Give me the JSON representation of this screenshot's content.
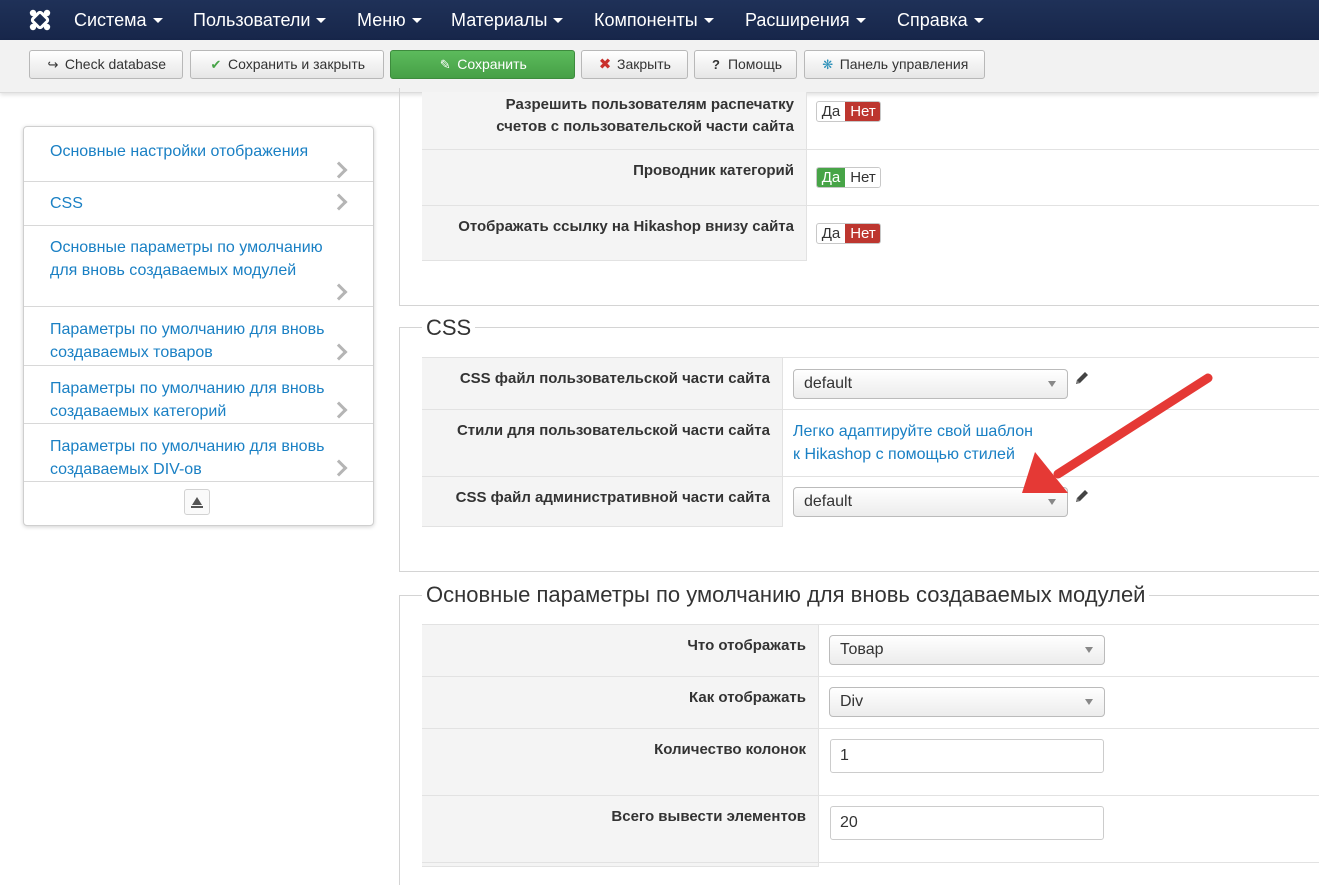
{
  "nav": {
    "items": [
      {
        "label": "Система"
      },
      {
        "label": "Пользователи"
      },
      {
        "label": "Меню"
      },
      {
        "label": "Материалы"
      },
      {
        "label": "Компоненты"
      },
      {
        "label": "Расширения"
      },
      {
        "label": "Справка"
      }
    ]
  },
  "toolbar": {
    "check_db": "Check database",
    "save_close": "Сохранить и закрыть",
    "save": "Сохранить",
    "close": "Закрыть",
    "help": "Помощь",
    "cpanel": "Панель управления"
  },
  "sidebar": {
    "items": [
      {
        "label": "Основные настройки отображения"
      },
      {
        "label": "CSS"
      },
      {
        "label": "Основные параметры по умолчанию для вновь создаваемых модулей"
      },
      {
        "label": "Параметры по умолчанию для вновь создаваемых товаров"
      },
      {
        "label": "Параметры по умолчанию для вновь создаваемых категорий"
      },
      {
        "label": "Параметры по умолчанию для вновь создаваемых DIV-ов"
      }
    ]
  },
  "display": {
    "rows": [
      {
        "label_l1": "Разрешить пользователям распечатку",
        "label_l2": "счетов с пользовательской части сайта",
        "yes": "Да",
        "no": "Нет",
        "value": "no"
      },
      {
        "label_l1": "Проводник категорий",
        "yes": "Да",
        "no": "Нет",
        "value": "yes"
      },
      {
        "label_l1": "Отображать ссылку на Hikashop внизу сайта",
        "yes": "Да",
        "no": "Нет",
        "value": "no"
      }
    ]
  },
  "css": {
    "legend": "CSS",
    "front_label": "CSS файл пользовательской части сайта",
    "front_value": "default",
    "styles_label": "Стили для пользовательской части сайта",
    "styles_link_l1": "Легко адаптируйте свой шаблон",
    "styles_link_l2": "к Hikashop с помощью стилей",
    "back_label": "CSS файл административной части сайта",
    "back_value": "default"
  },
  "modules": {
    "legend": "Основные параметры по умолчанию для вновь создаваемых модулей",
    "what_label": "Что отображать",
    "what_value": "Товар",
    "how_label": "Как отображать",
    "how_value": "Div",
    "cols_label": "Количество колонок",
    "cols_value": "1",
    "total_label": "Всего вывести элементов",
    "total_value": "20"
  },
  "colors": {
    "navbar": "#1b2b4d",
    "link": "#1a80c4",
    "yes_active": "#47a447",
    "no_active": "#bd362f",
    "annotation_arrow": "#e53935"
  }
}
